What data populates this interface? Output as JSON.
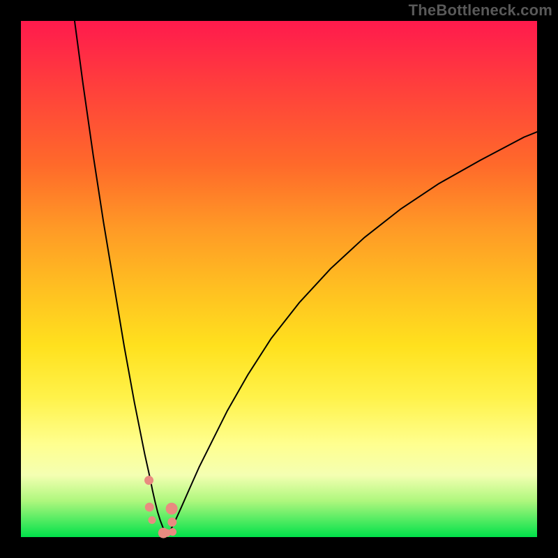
{
  "watermark": "TheBottleneck.com",
  "colors": {
    "curve_stroke": "#000000",
    "marker_fill": "#e98b80",
    "marker_stroke": "#e98b80"
  },
  "chart_data": {
    "type": "line",
    "title": "",
    "xlabel": "",
    "ylabel": "",
    "xlim": [
      0,
      100
    ],
    "ylim": [
      0,
      100
    ],
    "note": "Two curve branches forming a narrow V-shaped dip near x≈27 reaching y≈0, with scattered points near the dip. Values estimated from pixel positions (no axis labels present).",
    "series": [
      {
        "name": "left_branch",
        "x": [
          10.4,
          12.0,
          14.0,
          16.0,
          18.0,
          20.0,
          22.0,
          23.0,
          24.0,
          25.0,
          25.5,
          26.0,
          26.5,
          27.0,
          27.5,
          28.0,
          28.3
        ],
        "y": [
          100.0,
          88.0,
          74.0,
          61.0,
          49.0,
          37.0,
          26.0,
          21.0,
          16.0,
          11.5,
          9.0,
          6.8,
          4.8,
          3.2,
          1.9,
          0.9,
          0.3
        ]
      },
      {
        "name": "right_branch",
        "x": [
          28.3,
          29.0,
          30.0,
          31.0,
          32.5,
          34.5,
          37.0,
          40.0,
          44.0,
          48.5,
          54.0,
          60.0,
          66.5,
          73.5,
          81.0,
          89.0,
          97.5,
          100.0
        ],
        "y": [
          0.3,
          1.4,
          3.4,
          5.6,
          9.0,
          13.5,
          18.5,
          24.5,
          31.5,
          38.5,
          45.5,
          52.0,
          58.0,
          63.5,
          68.5,
          73.0,
          77.5,
          78.5
        ]
      }
    ],
    "markers": {
      "name": "dip_points",
      "x": [
        24.8,
        24.9,
        25.4,
        27.6,
        28.3,
        29.2,
        29.3,
        29.4
      ],
      "y": [
        11.0,
        5.8,
        3.3,
        0.8,
        0.8,
        5.5,
        2.9,
        1.0
      ],
      "r": [
        6,
        6,
        5,
        7,
        5,
        8,
        6,
        5
      ]
    }
  }
}
